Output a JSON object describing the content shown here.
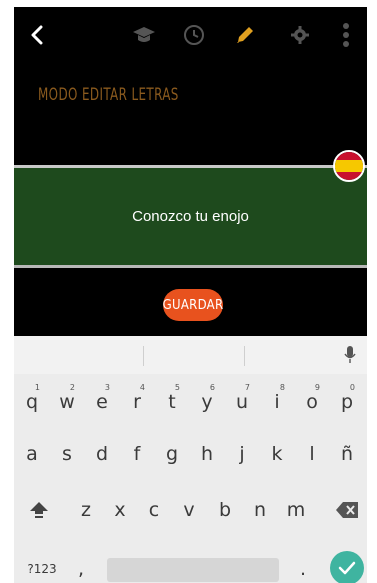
{
  "toolbar": {
    "icons": [
      "back-arrow-icon",
      "graduation-cap-icon",
      "clock-icon",
      "pencil-icon",
      "gear-icon",
      "more-vertical-icon"
    ],
    "colors": {
      "pencil": "#e0a020",
      "icons": "#555555"
    }
  },
  "mode_title": "MODO EDITAR LETRAS",
  "lyric_text": "Conozco tu enojo",
  "language_flag": "spain-flag-icon",
  "save_button": "GUARDAR",
  "colors": {
    "lyric_background": "#1e4a1d",
    "save": "#e8521e",
    "enter": "#3fb4a0"
  },
  "keyboard": {
    "row1": [
      "q",
      "w",
      "e",
      "r",
      "t",
      "y",
      "u",
      "i",
      "o",
      "p"
    ],
    "row1_hints": [
      "1",
      "2",
      "3",
      "4",
      "5",
      "6",
      "7",
      "8",
      "9",
      "0"
    ],
    "row2": [
      "a",
      "s",
      "d",
      "f",
      "g",
      "h",
      "j",
      "k",
      "l",
      "ñ"
    ],
    "row3": [
      "z",
      "x",
      "c",
      "v",
      "b",
      "n",
      "m"
    ],
    "symbols_key": "?123",
    "comma_key": ",",
    "period_key": "."
  }
}
